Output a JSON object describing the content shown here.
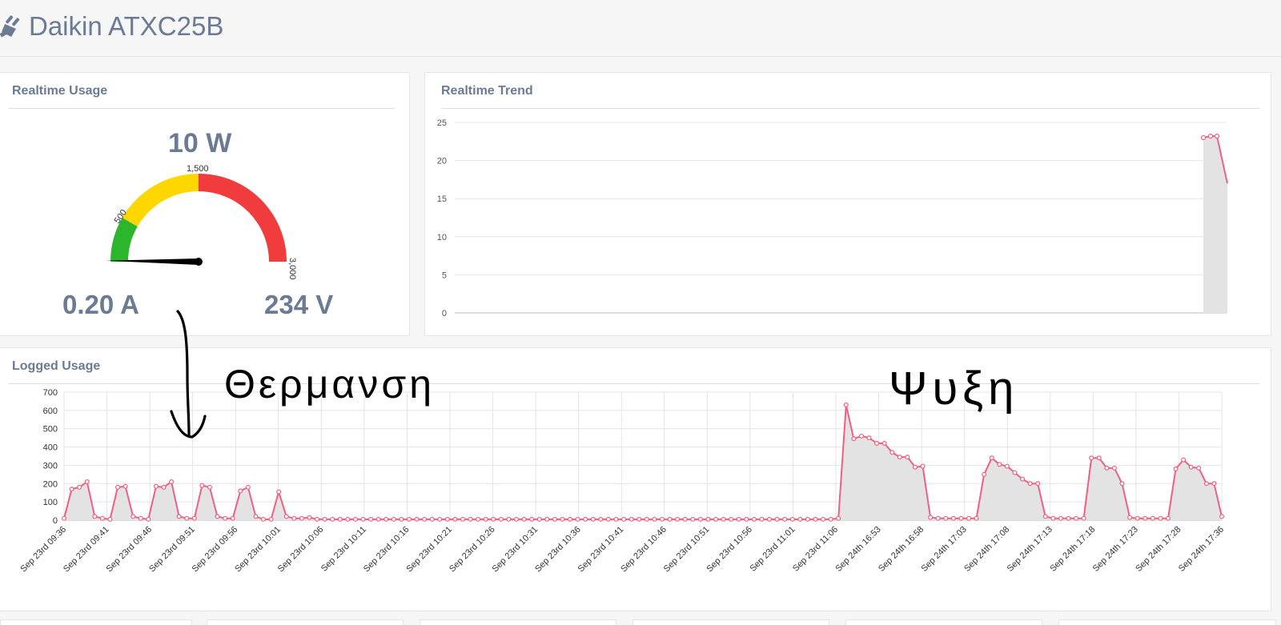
{
  "header": {
    "title": "Daikin ATXC25B",
    "icon": "plug-icon"
  },
  "realtime_usage": {
    "title": "Realtime Usage",
    "power": "10 W",
    "current": "0.20 A",
    "voltage": "234 V",
    "gauge": {
      "min": 0,
      "max": 3000,
      "value": 10,
      "tick_labels": [
        "500",
        "1,500",
        "3,000"
      ],
      "bands": [
        {
          "from": 0,
          "to": 500,
          "color": "#2db52d"
        },
        {
          "from": 500,
          "to": 1500,
          "color": "#ffd700"
        },
        {
          "from": 1500,
          "to": 3000,
          "color": "#f03c3c"
        }
      ]
    }
  },
  "realtime_trend": {
    "title": "Realtime Trend",
    "chart_data": {
      "type": "area",
      "y_ticks": [
        "0",
        "5",
        "10",
        "15",
        "20",
        "25"
      ],
      "ylim": [
        0,
        25
      ],
      "values": [
        23,
        23.2,
        23.2,
        17
      ],
      "line_color": "#f06080",
      "fill_color": "#e3e3e3",
      "grid": true
    }
  },
  "logged_usage": {
    "title": "Logged Usage",
    "chart_data": {
      "type": "area",
      "ylim": [
        0,
        700
      ],
      "y_ticks": [
        "0",
        "100",
        "200",
        "300",
        "400",
        "500",
        "600",
        "700"
      ],
      "x_labels": [
        "Sep 23rd 09:36",
        "Sep 23rd 09:41",
        "Sep 23rd 09:46",
        "Sep 23rd 09:51",
        "Sep 23rd 09:56",
        "Sep 23rd 10:01",
        "Sep 23rd 10:06",
        "Sep 23rd 10:11",
        "Sep 23rd 10:16",
        "Sep 23rd 10:21",
        "Sep 23rd 10:26",
        "Sep 23rd 10:31",
        "Sep 23rd 10:36",
        "Sep 23rd 10:41",
        "Sep 23rd 10:46",
        "Sep 23rd 10:51",
        "Sep 23rd 10:56",
        "Sep 23rd 11:01",
        "Sep 23rd 11:06",
        "Sep 24th 16:53",
        "Sep 24th 16:58",
        "Sep 24th 17:03",
        "Sep 24th 17:08",
        "Sep 24th 17:13",
        "Sep 24th 17:18",
        "Sep 24th 17:23",
        "Sep 24th 17:28",
        "Sep 24th 17:36"
      ],
      "values": [
        10,
        170,
        180,
        210,
        20,
        10,
        5,
        180,
        185,
        20,
        10,
        5,
        185,
        180,
        210,
        20,
        10,
        10,
        190,
        180,
        20,
        10,
        10,
        160,
        180,
        20,
        5,
        5,
        155,
        20,
        10,
        10,
        15,
        5,
        5,
        5,
        5,
        5,
        5,
        5,
        5,
        5,
        5,
        5,
        5,
        5,
        5,
        5,
        5,
        5,
        5,
        5,
        5,
        5,
        5,
        5,
        5,
        5,
        5,
        5,
        5,
        5,
        5,
        5,
        5,
        5,
        5,
        5,
        5,
        5,
        5,
        5,
        5,
        5,
        5,
        5,
        5,
        5,
        5,
        5,
        5,
        5,
        5,
        5,
        5,
        5,
        5,
        5,
        5,
        5,
        5,
        5,
        5,
        5,
        5,
        5,
        5,
        5,
        5,
        5,
        5,
        10,
        630,
        445,
        460,
        450,
        420,
        420,
        370,
        345,
        345,
        290,
        295,
        15,
        10,
        10,
        10,
        10,
        10,
        10,
        250,
        340,
        305,
        295,
        260,
        225,
        200,
        200,
        20,
        10,
        10,
        10,
        10,
        10,
        340,
        340,
        285,
        285,
        200,
        15,
        10,
        10,
        10,
        10,
        10,
        280,
        330,
        290,
        285,
        200,
        200,
        20
      ],
      "line_color": "#f06080",
      "fill_color": "#e3e3e3",
      "grid": true
    }
  },
  "annotations": {
    "left_word": "Θερμανση",
    "right_word": "Ψυξη",
    "ink_color": "#000000"
  }
}
